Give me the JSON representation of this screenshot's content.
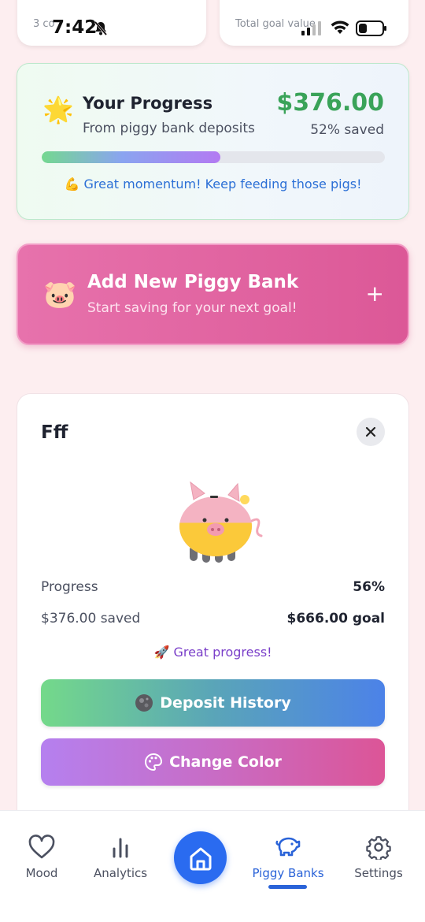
{
  "status_bar": {
    "time": "7:42"
  },
  "top_cards": {
    "left_peek": "3 co",
    "right_peek": "Total goal value"
  },
  "progress": {
    "title": "Your Progress",
    "subtitle": "From piggy bank deposits",
    "amount": "$376.00",
    "percent_label": "52% saved",
    "fill_fraction": 0.52,
    "motivation": "💪 Great momentum! Keep feeding those pigs!"
  },
  "add_bank": {
    "title": "Add New Piggy Bank",
    "subtitle": "Start saving for your next goal!",
    "plus": "+"
  },
  "bank": {
    "name": "Fff",
    "progress_label": "Progress",
    "progress_value": "56%",
    "saved_label": "$376.00 saved",
    "goal_label": "$666.00 goal",
    "fill_fraction": 0.56,
    "encouragement": "🚀 Great progress!",
    "deposit_button": "Deposit History",
    "color_button": "Change Color"
  },
  "nav": {
    "mood": "Mood",
    "analytics": "Analytics",
    "piggy": "Piggy Banks",
    "settings": "Settings",
    "active": "Piggy Banks"
  },
  "colors": {
    "accent_blue": "#2a6bf0",
    "money_green": "#3aa359",
    "pink": "#dc5897"
  }
}
